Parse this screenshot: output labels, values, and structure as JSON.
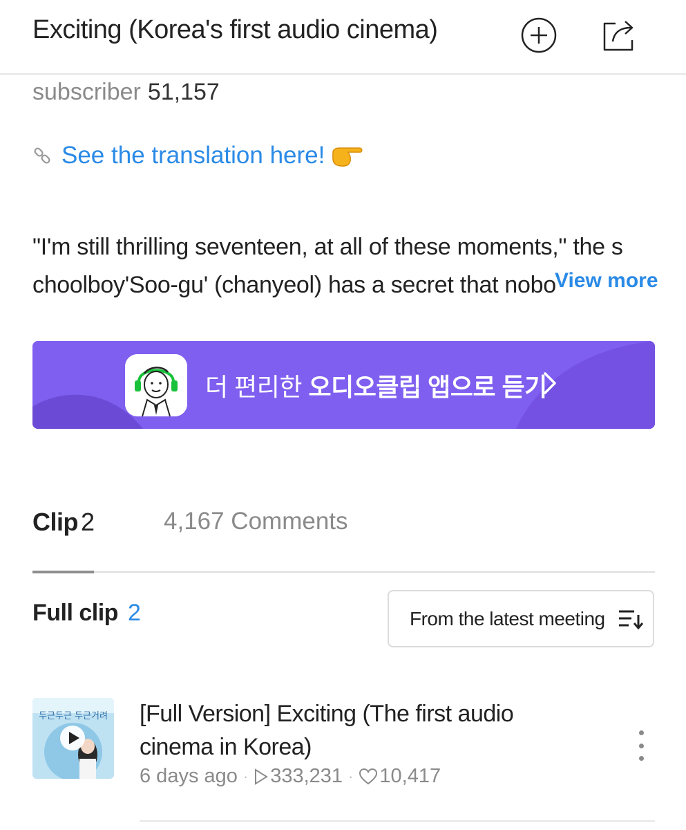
{
  "header": {
    "title": "Exciting (Korea's first audio cinema)",
    "add_icon": "plus-circle-icon",
    "share_icon": "share-icon"
  },
  "channel": {
    "subscriber_label": "subscriber",
    "subscriber_count": "51,157",
    "translation_link": "See the translation here!",
    "link_icon": "link-icon",
    "emoji_icon": "pointing-hand-icon",
    "description_lines": [
      "\"I'm still thrilling seventeen, at all of these moments,\" the s",
      "choolboy'Soo-gu' (chanyeol) has a secret that nobo"
    ],
    "view_more": "View more"
  },
  "banner": {
    "text_light": "더 편리한 ",
    "text_bold": "오디오클립",
    "text_end": " 앱으로 듣기",
    "app_icon": "audioclip-app-icon",
    "arrow_icon": "chevron-right-icon",
    "color": "#7f5ff0"
  },
  "tabs": {
    "clip_label": "Clip",
    "clip_count": "2",
    "comments_label": "4,167 Comments"
  },
  "list": {
    "section_label": "Full clip",
    "section_count": "2",
    "sort_label": "From the latest meeting",
    "sort_icon": "sort-icon",
    "items": [
      {
        "title": "[Full Version] Exciting (The first audio cinema in Korea)",
        "date": "6 days ago",
        "plays": "333,231",
        "likes": "10,417",
        "thumb_text": "두근두근 두근거려"
      }
    ]
  },
  "colors": {
    "accent": "#2a8ae6",
    "banner": "#7f5ff0",
    "text": "#222222",
    "muted": "#8a8a8a"
  }
}
